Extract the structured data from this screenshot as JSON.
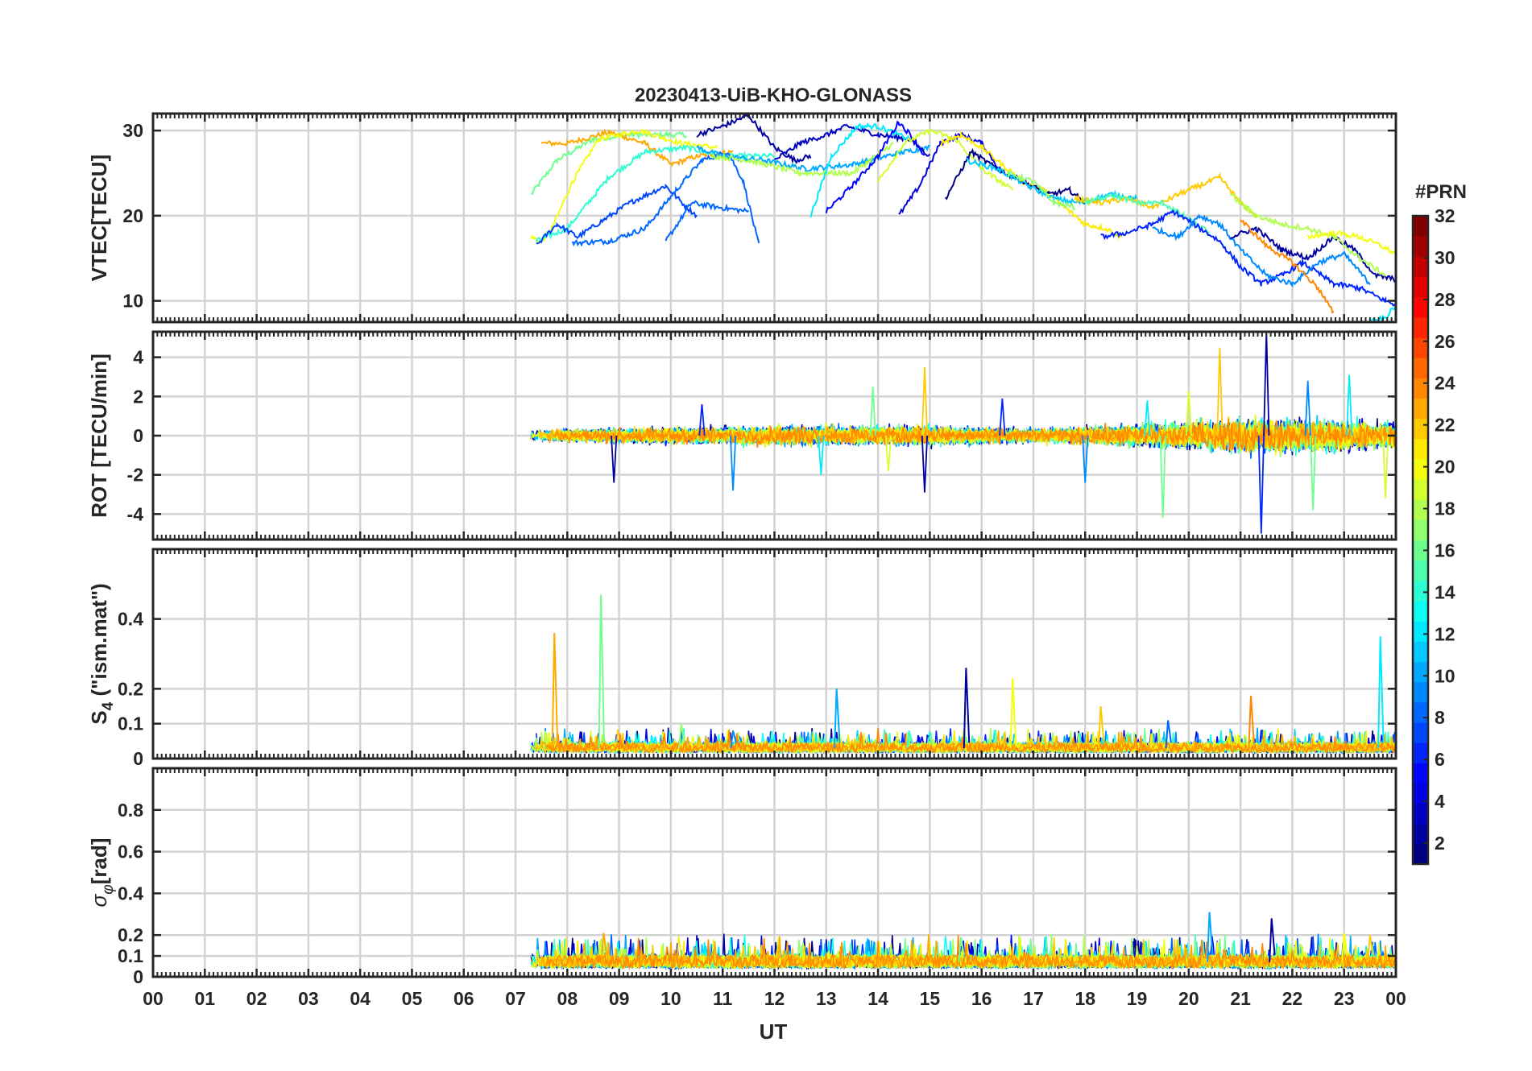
{
  "figure": {
    "title": "20230413-UiB-KHO-GLONASS",
    "xlabel": "UT",
    "x_tick_labels": [
      "00",
      "01",
      "02",
      "03",
      "04",
      "05",
      "06",
      "07",
      "08",
      "09",
      "10",
      "11",
      "12",
      "13",
      "14",
      "15",
      "16",
      "17",
      "18",
      "19",
      "20",
      "21",
      "22",
      "23",
      "00"
    ]
  },
  "colorbar": {
    "title": "#PRN",
    "range": [
      1,
      32
    ],
    "tick_labels": [
      "2",
      "4",
      "6",
      "8",
      "10",
      "12",
      "14",
      "16",
      "18",
      "20",
      "22",
      "24",
      "26",
      "28",
      "30",
      "32"
    ],
    "colormap": "jet"
  },
  "chart_data": [
    {
      "type": "line",
      "panel": "vtec",
      "ylabel": "VTEC[TECU]",
      "xlim": [
        0,
        24
      ],
      "ylim": [
        7.5,
        32
      ],
      "yticks": [
        10,
        20,
        30
      ],
      "grid": true,
      "series": [
        {
          "prn": 16,
          "x": [
            7.3,
            7.8,
            8.5,
            9.2,
            9.9,
            10.3
          ],
          "y": [
            22.5,
            26.5,
            29.0,
            29.5,
            29.5,
            29.5
          ]
        },
        {
          "prn": 23,
          "x": [
            7.5,
            8.0,
            8.8,
            9.5,
            10.0,
            10.5,
            11.2
          ],
          "y": [
            28.5,
            28.5,
            29.8,
            28.5,
            26.0,
            27.0,
            27.5
          ]
        },
        {
          "prn": 20,
          "x": [
            7.3,
            7.5,
            7.7,
            8.1,
            8.6,
            9.4,
            10.2,
            10.9
          ],
          "y": [
            17.5,
            17.0,
            18.5,
            24.0,
            29.0,
            30.0,
            28.5,
            28.0
          ]
        },
        {
          "prn": 14,
          "x": [
            7.4,
            8.0,
            8.8,
            9.5,
            10.3,
            11.0,
            12.0
          ],
          "y": [
            17.0,
            18.5,
            24.5,
            27.5,
            28.0,
            27.0,
            27.0
          ]
        },
        {
          "prn": 7,
          "x": [
            7.4,
            7.8,
            8.2,
            8.7,
            9.2,
            9.9,
            10.3,
            10.5
          ],
          "y": [
            16.5,
            19.0,
            17.5,
            19.5,
            21.5,
            23.5,
            21.0,
            20.0
          ]
        },
        {
          "prn": 8,
          "x": [
            8.1,
            8.8,
            9.5,
            10.1,
            10.6,
            11.1,
            11.4,
            11.7
          ],
          "y": [
            16.8,
            17.0,
            18.5,
            23.0,
            26.5,
            27.5,
            24.0,
            16.5
          ]
        },
        {
          "prn": 8,
          "x": [
            9.9,
            10.4,
            10.9,
            11.5
          ],
          "y": [
            17.0,
            21.5,
            21.0,
            20.5
          ]
        },
        {
          "prn": 2,
          "x": [
            10.5,
            11.0,
            11.5,
            12.0,
            12.4,
            12.7
          ],
          "y": [
            29.5,
            30.5,
            31.8,
            28.0,
            26.5,
            27.0
          ]
        },
        {
          "prn": 10,
          "x": [
            10.5,
            11.0,
            11.8,
            12.6,
            13.5,
            14.5,
            15.0
          ],
          "y": [
            28.0,
            27.0,
            26.5,
            25.5,
            26.0,
            27.5,
            28.0
          ]
        },
        {
          "prn": 18,
          "x": [
            10.8,
            11.5,
            12.5,
            13.5,
            14.3
          ],
          "y": [
            27.0,
            26.5,
            25.0,
            25.0,
            28.5
          ]
        },
        {
          "prn": 3,
          "x": [
            12.0,
            12.5,
            13.0,
            13.4,
            14.0,
            14.6,
            15.0
          ],
          "y": [
            26.5,
            28.5,
            29.5,
            30.5,
            29.5,
            29.0,
            27.0
          ]
        },
        {
          "prn": 12,
          "x": [
            12.7,
            13.1,
            13.6,
            14.0,
            14.6
          ],
          "y": [
            20.0,
            27.0,
            30.5,
            30.5,
            29.0
          ]
        },
        {
          "prn": 5,
          "x": [
            13.0,
            13.5,
            14.0,
            14.4,
            14.7,
            14.9
          ],
          "y": [
            20.5,
            23.5,
            27.0,
            31.0,
            29.0,
            27.0
          ]
        },
        {
          "prn": 4,
          "x": [
            14.4,
            14.8,
            15.2,
            15.6,
            16.0,
            16.4
          ],
          "y": [
            20.0,
            23.5,
            28.5,
            29.5,
            28.5,
            25.0
          ]
        },
        {
          "prn": 19,
          "x": [
            14.0,
            14.5,
            15.0,
            15.5,
            16.0,
            16.6
          ],
          "y": [
            24.0,
            28.5,
            30.0,
            29.0,
            25.5,
            23.0
          ]
        },
        {
          "prn": 21,
          "x": [
            15.2,
            15.6,
            16.0,
            16.4,
            16.8,
            17.2,
            17.6,
            18.0,
            18.4,
            18.7
          ],
          "y": [
            28.5,
            29.5,
            28.0,
            26.0,
            24.0,
            23.0,
            21.0,
            19.0,
            18.5,
            17.5
          ]
        },
        {
          "prn": 1,
          "x": [
            15.3,
            15.8,
            16.3,
            16.8,
            17.3,
            17.7,
            18.0
          ],
          "y": [
            22.0,
            27.5,
            25.5,
            24.0,
            22.5,
            23.0,
            21.5
          ]
        },
        {
          "prn": 11,
          "x": [
            15.7,
            16.3,
            16.9,
            17.4,
            17.9,
            18.5,
            19.0
          ],
          "y": [
            26.5,
            25.5,
            23.5,
            22.0,
            21.5,
            22.5,
            22.0
          ]
        },
        {
          "prn": 17,
          "x": [
            16.5,
            17.0,
            17.4,
            17.8
          ],
          "y": [
            25.0,
            24.0,
            21.5,
            21.0
          ]
        },
        {
          "prn": 22,
          "x": [
            17.8,
            18.3,
            18.8,
            19.3,
            19.8,
            20.2,
            20.6,
            21.0,
            21.3
          ],
          "y": [
            22.0,
            21.5,
            22.0,
            21.0,
            22.5,
            23.5,
            24.5,
            21.5,
            20.0
          ]
        },
        {
          "prn": 15,
          "x": [
            18.0,
            18.5,
            19.0,
            19.5,
            19.9,
            20.4
          ],
          "y": [
            21.5,
            22.5,
            21.5,
            21.5,
            20.0,
            18.0
          ]
        },
        {
          "prn": 6,
          "x": [
            18.3,
            18.8,
            19.3,
            19.7,
            20.1,
            20.6,
            21.0,
            21.4,
            21.8,
            22.2,
            22.8,
            23.3,
            23.8,
            24.0
          ],
          "y": [
            17.5,
            18.0,
            19.0,
            20.5,
            19.0,
            17.0,
            14.0,
            12.0,
            13.0,
            14.5,
            12.0,
            11.5,
            10.0,
            9.5
          ]
        },
        {
          "prn": 9,
          "x": [
            19.3,
            19.8,
            20.2,
            20.6,
            21.0,
            21.5,
            22.0,
            22.5,
            23.0,
            23.5
          ],
          "y": [
            18.5,
            17.5,
            20.0,
            19.0,
            16.0,
            13.0,
            12.0,
            14.5,
            15.5,
            12.0
          ]
        },
        {
          "prn": 2,
          "x": [
            20.8,
            21.3,
            21.8,
            22.3,
            22.8,
            23.2,
            23.6,
            24.0
          ],
          "y": [
            17.5,
            18.5,
            16.0,
            15.0,
            17.5,
            16.0,
            13.0,
            12.5
          ]
        },
        {
          "prn": 18,
          "x": [
            20.8,
            21.3,
            21.8,
            22.3,
            22.8,
            23.3,
            23.8
          ],
          "y": [
            22.5,
            20.0,
            19.0,
            18.5,
            17.5,
            15.0,
            13.0
          ]
        },
        {
          "prn": 24,
          "x": [
            21.0,
            21.5,
            22.0,
            22.5,
            22.8
          ],
          "y": [
            19.5,
            16.5,
            14.5,
            11.5,
            8.5
          ]
        },
        {
          "prn": 20,
          "x": [
            22.3,
            22.8,
            23.3,
            23.7,
            24.0
          ],
          "y": [
            17.5,
            18.0,
            17.5,
            16.5,
            15.5
          ]
        },
        {
          "prn": 12,
          "x": [
            23.5,
            23.8,
            24.0
          ],
          "y": [
            7.5,
            8.0,
            9.5
          ]
        }
      ]
    },
    {
      "type": "line",
      "panel": "rot",
      "ylabel": "ROT [TECU/min]",
      "xlim": [
        0,
        24
      ],
      "ylim": [
        -5.3,
        5.3
      ],
      "yticks": [
        -4,
        -2,
        0,
        2,
        4
      ],
      "grid": true,
      "data_range": [
        7.3,
        24
      ],
      "activity": [
        [
          7.3,
          0.4
        ],
        [
          10.5,
          0.6
        ],
        [
          12.5,
          0.7
        ],
        [
          15,
          0.7
        ],
        [
          17,
          0.5
        ],
        [
          19,
          0.8
        ],
        [
          21,
          1.2
        ],
        [
          23,
          1.1
        ],
        [
          24,
          0.9
        ]
      ],
      "spikes": [
        {
          "x": 8.9,
          "y": -2.4
        },
        {
          "x": 10.6,
          "y": 1.6
        },
        {
          "x": 11.2,
          "y": -2.8
        },
        {
          "x": 12.9,
          "y": -2.0
        },
        {
          "x": 13.9,
          "y": 2.5
        },
        {
          "x": 14.2,
          "y": -1.8
        },
        {
          "x": 14.9,
          "y": 3.5
        },
        {
          "x": 14.9,
          "y": -2.9
        },
        {
          "x": 16.4,
          "y": 1.9
        },
        {
          "x": 18.0,
          "y": -2.4
        },
        {
          "x": 19.2,
          "y": 1.8
        },
        {
          "x": 19.5,
          "y": -4.2
        },
        {
          "x": 20.0,
          "y": 2.3
        },
        {
          "x": 20.6,
          "y": 4.5
        },
        {
          "x": 21.5,
          "y": 5.3
        },
        {
          "x": 21.4,
          "y": -5.0
        },
        {
          "x": 22.3,
          "y": 2.8
        },
        {
          "x": 23.1,
          "y": 3.1
        },
        {
          "x": 22.4,
          "y": -3.8
        },
        {
          "x": 23.8,
          "y": -3.2
        }
      ]
    },
    {
      "type": "line",
      "panel": "s4",
      "ylabel": "S4 (\"ism.mat\")",
      "xlim": [
        0,
        24
      ],
      "ylim": [
        0,
        0.6
      ],
      "yticks": [
        0,
        0.1,
        0.2,
        0.4
      ],
      "grid": true,
      "baseline": 0.03,
      "data_range": [
        7.3,
        24
      ],
      "spikes": [
        {
          "x": 7.75,
          "y": 0.36
        },
        {
          "x": 8.65,
          "y": 0.47
        },
        {
          "x": 13.2,
          "y": 0.2
        },
        {
          "x": 15.7,
          "y": 0.26
        },
        {
          "x": 16.6,
          "y": 0.23
        },
        {
          "x": 18.3,
          "y": 0.15
        },
        {
          "x": 21.2,
          "y": 0.18
        },
        {
          "x": 23.7,
          "y": 0.35
        },
        {
          "x": 10.2,
          "y": 0.1
        },
        {
          "x": 11.2,
          "y": 0.08
        },
        {
          "x": 14.6,
          "y": 0.08
        },
        {
          "x": 19.6,
          "y": 0.11
        }
      ]
    },
    {
      "type": "line",
      "panel": "sigma_phi",
      "ylabel": "σφ[rad]",
      "xlim": [
        0,
        24
      ],
      "ylim": [
        0,
        1
      ],
      "yticks": [
        0,
        0.1,
        0.2,
        0.4,
        0.6,
        0.8
      ],
      "grid": true,
      "baseline": 0.07,
      "data_range": [
        7.3,
        24
      ],
      "spikes": [
        {
          "x": 8.7,
          "y": 0.21
        },
        {
          "x": 15.6,
          "y": 0.19
        },
        {
          "x": 20.4,
          "y": 0.31
        },
        {
          "x": 21.6,
          "y": 0.28
        },
        {
          "x": 23.0,
          "y": 0.21
        },
        {
          "x": 23.5,
          "y": 0.2
        }
      ]
    }
  ]
}
